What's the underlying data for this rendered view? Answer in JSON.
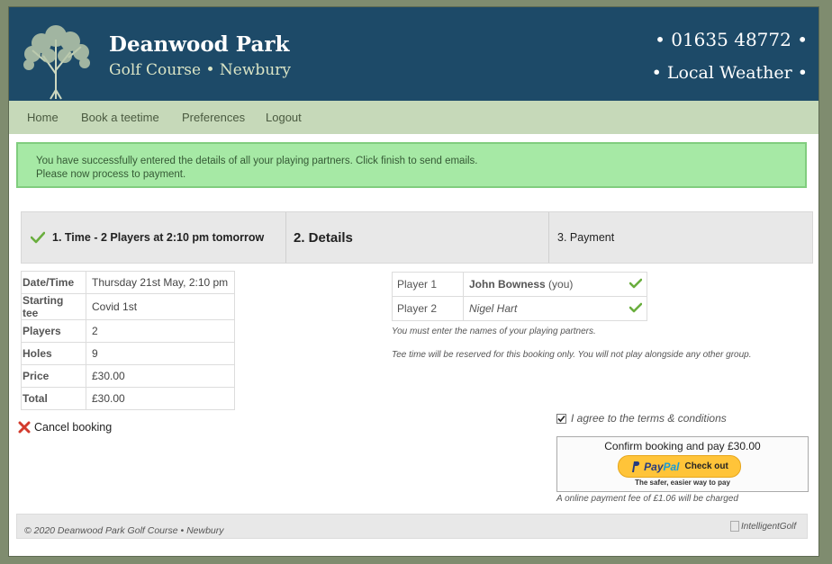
{
  "header": {
    "title": "Deanwood Park",
    "subtitle": "Golf Course • Newbury",
    "phone": "• 01635 48772 •",
    "weather": "• Local Weather •"
  },
  "nav": {
    "items": [
      "Home",
      "Book a teetime",
      "Preferences",
      "Logout"
    ]
  },
  "alert": {
    "line1": "You have successfully entered the details of all your playing partners. Click finish to send emails.",
    "line2": "Please now process to payment."
  },
  "steps": {
    "step1": "1. Time - 2 Players at 2:10 pm tomorrow",
    "step2": "2. Details",
    "step3": "3. Payment"
  },
  "booking": {
    "rows": [
      {
        "label": "Date/Time",
        "value": "Thursday 21st May, 2:10 pm"
      },
      {
        "label": "Starting tee",
        "value": "Covid 1st"
      },
      {
        "label": "Players",
        "value": "2"
      },
      {
        "label": "Holes",
        "value": "9"
      },
      {
        "label": "Price",
        "value": "£30.00"
      },
      {
        "label": "Total",
        "value": "£30.00"
      }
    ]
  },
  "cancel_label": "Cancel booking",
  "players": {
    "rows": [
      {
        "label": "Player 1",
        "name": "John Bowness",
        "suffix": " (you)"
      },
      {
        "label": "Player 2",
        "name": "Nigel Hart"
      }
    ],
    "note1": "You must enter the names of your playing partners.",
    "note2": "Tee time will be reserved for this booking only. You will not play alongside any other group."
  },
  "payment": {
    "agree_label": "I agree to the terms & conditions",
    "agree_checked": true,
    "confirm_label": "Confirm booking and pay £30.00",
    "paypal_pay": "Pay",
    "paypal_pal": "Pal",
    "paypal_checkout": "Check out",
    "paypal_tagline": "The safer, easier way to pay",
    "fee_note": "A online payment fee of £1.06 will be charged"
  },
  "footer": {
    "copyright": "© 2020 Deanwood Park Golf Course • Newbury",
    "brand_alt": "IntelligentGolf"
  },
  "colors": {
    "header_bg": "#1d4a68",
    "nav_bg": "#c6d9b9",
    "alert_bg": "#a6e9a5",
    "check_green": "#6aae3e",
    "cancel_red": "#d33a2c",
    "paypal_yellow": "#ffc439"
  }
}
